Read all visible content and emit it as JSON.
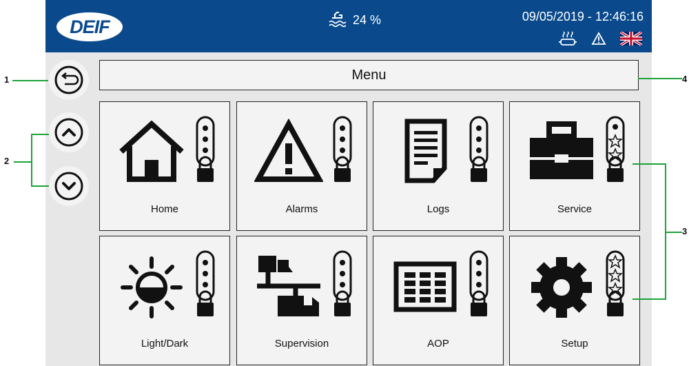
{
  "header": {
    "logo_text": "DEIF",
    "fuel_level": "24 %",
    "datetime": "09/05/2019 - 12:46:16",
    "status_icons": [
      "engine-heater-icon",
      "warning-icon",
      "uk-flag-icon"
    ]
  },
  "side_nav": {
    "buttons": [
      "back-icon",
      "scroll-up-icon",
      "scroll-down-icon"
    ]
  },
  "menu": {
    "title": "Menu",
    "tiles": [
      {
        "label": "Home",
        "icon": "home-icon",
        "access": "basic"
      },
      {
        "label": "Alarms",
        "icon": "alarm-icon",
        "access": "basic"
      },
      {
        "label": "Logs",
        "icon": "logs-icon",
        "access": "basic"
      },
      {
        "label": "Service",
        "icon": "toolbox-icon",
        "access": "2-star"
      },
      {
        "label": "Light/Dark",
        "icon": "light-dark-icon",
        "access": "basic"
      },
      {
        "label": "Supervision",
        "icon": "supervision-icon",
        "access": "basic"
      },
      {
        "label": "AOP",
        "icon": "aop-icon",
        "access": "basic"
      },
      {
        "label": "Setup",
        "icon": "gear-icon",
        "access": "3-star"
      }
    ]
  },
  "callouts": {
    "c1": "1",
    "c2": "2",
    "c3": "3",
    "c4": "4"
  },
  "colors": {
    "header": "#0a4a8c",
    "background": "#e7e7e7",
    "callout_line": "#19a337"
  }
}
